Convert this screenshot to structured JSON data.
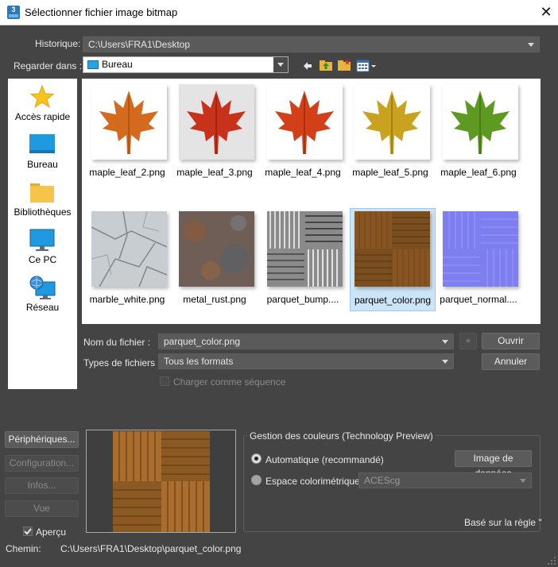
{
  "window": {
    "title": "Sélectionner fichier image bitmap",
    "app_badge": "3"
  },
  "historique": {
    "label": "Historique:",
    "value": "C:\\Users\\FRA1\\Desktop"
  },
  "regarder": {
    "label": "Regarder dans :",
    "value": "Bureau"
  },
  "toolbar": [
    {
      "icon": "back-arrow-icon"
    },
    {
      "icon": "up-folder-icon"
    },
    {
      "icon": "new-folder-icon"
    },
    {
      "icon": "view-menu-icon"
    }
  ],
  "sidebar": [
    {
      "label": "Accès rapide",
      "icon": "star-icon"
    },
    {
      "label": "Bureau",
      "icon": "desktop-icon"
    },
    {
      "label": "Bibliothèques",
      "icon": "folder-icon"
    },
    {
      "label": "Ce PC",
      "icon": "monitor-icon"
    },
    {
      "label": "Réseau",
      "icon": "network-icon"
    }
  ],
  "files": [
    {
      "name": "maple_leaf_2.png",
      "kind": "leaf",
      "color": "#d46a1e",
      "bg": "#ffffff"
    },
    {
      "name": "maple_leaf_3.png",
      "kind": "leaf",
      "color": "#c8311a",
      "bg": "#e4e4e4"
    },
    {
      "name": "maple_leaf_4.png",
      "kind": "leaf",
      "color": "#d2401a",
      "bg": "#ffffff"
    },
    {
      "name": "maple_leaf_5.png",
      "kind": "leaf",
      "color": "#c9a21f",
      "bg": "#ffffff"
    },
    {
      "name": "maple_leaf_6.png",
      "kind": "leaf",
      "color": "#5e9a22",
      "bg": "#ffffff"
    },
    {
      "name": "marble_white.png",
      "kind": "marble",
      "color": "#c7cdd1",
      "bg": "#c7cdd1"
    },
    {
      "name": "metal_rust.png",
      "kind": "rust",
      "color": "#6e5a4c",
      "bg": "#6e5a4c"
    },
    {
      "name": "parquet_bump....",
      "kind": "bump",
      "color": "#9a9a9a",
      "bg": "#9a9a9a"
    },
    {
      "name": "parquet_color.png",
      "kind": "parquet",
      "color": "#8a5a22",
      "bg": "#8a5a22",
      "selected": true
    },
    {
      "name": "parquet_normal....",
      "kind": "normal",
      "color": "#7a7aef",
      "bg": "#7a7aef"
    }
  ],
  "filename": {
    "label": "Nom du fichier :",
    "value": "parquet_color.png"
  },
  "filetypes": {
    "label": "Types de fichiers :",
    "value": "Tous les formats"
  },
  "sequence": {
    "label": "Charger comme séquence"
  },
  "buttons": {
    "open": "Ouvrir",
    "cancel": "Annuler",
    "plus": "+",
    "devices": "Périphériques...",
    "config": "Configuration...",
    "info": "Infos...",
    "view": "Vue"
  },
  "apercu": {
    "label": "Aperçu",
    "checked": true
  },
  "color_mgmt": {
    "title": "Gestion des couleurs (Technology Preview)",
    "auto_label": "Automatique (recommandé)",
    "data_button": "Image de données",
    "space_label": "Espace colorimétrique:",
    "space_value": "ACEScg",
    "rule_text": "Basé sur la règle \""
  },
  "path": {
    "label": "Chemin:",
    "value": "C:\\Users\\FRA1\\Desktop\\parquet_color.png"
  }
}
